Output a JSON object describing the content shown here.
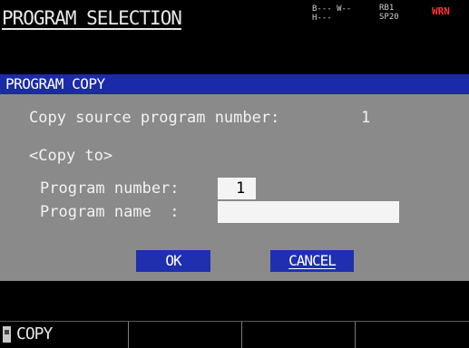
{
  "header": {
    "title": "PROGRAM SELECTION",
    "status_left": "B--- W--\nH---",
    "status_right": "RB1\nSP20",
    "alarm": "WRN"
  },
  "dialog": {
    "title": "PROGRAM COPY",
    "source_label": "Copy source program number:",
    "source_value": "1",
    "copy_to_label": "<Copy to>",
    "program_number_label": "Program number:",
    "program_number_value": "1",
    "program_name_label": "Program name  :",
    "program_name_value": "",
    "ok_label": "OK",
    "cancel_label": "CANCEL"
  },
  "softkeys": [
    {
      "label": "COPY",
      "icon": "copy-icon"
    },
    {
      "label": ""
    },
    {
      "label": ""
    },
    {
      "label": ""
    }
  ]
}
